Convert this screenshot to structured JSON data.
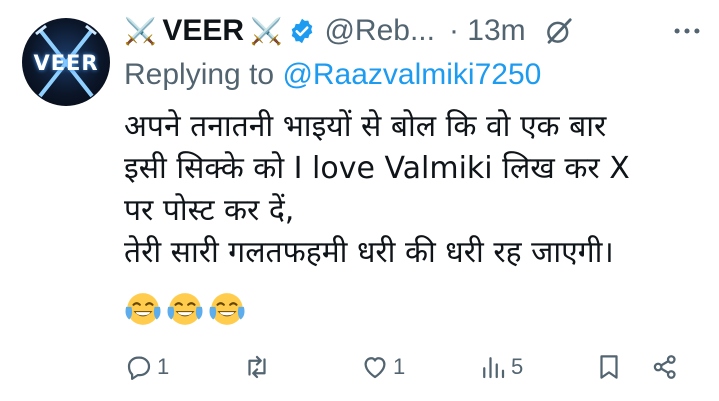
{
  "author": {
    "display_name": "VEER",
    "name_decoration": "⚔️",
    "handle": "@Reb...",
    "time": "· 13m",
    "avatar_text": "VEER",
    "verified_color": "#1d9bf0"
  },
  "reply": {
    "prefix": "Replying to",
    "to_handle": "@Raazvalmiki7250"
  },
  "tweet": {
    "text": "अपने तनातनी भाइयों से बोल कि वो एक बार\nइसी सिक्के को I love Valmiki लिख कर X\nपर पोस्ट कर दें,\nतेरी सारी गलतफहमी धरी की धरी रह जाएगी।",
    "emojis": [
      "face-with-tears-of-joy",
      "face-with-tears-of-joy",
      "face-with-tears-of-joy"
    ]
  },
  "actions": {
    "reply_count": "1",
    "repost_count": "",
    "like_count": "1",
    "views_count": "5"
  },
  "colors": {
    "accent": "#1d9bf0",
    "secondary_text": "#536471",
    "primary_text": "#0f1419"
  },
  "icons": [
    "grok-icon",
    "more-icon",
    "reply-icon",
    "repost-icon",
    "like-icon",
    "views-icon",
    "bookmark-icon",
    "share-icon"
  ]
}
